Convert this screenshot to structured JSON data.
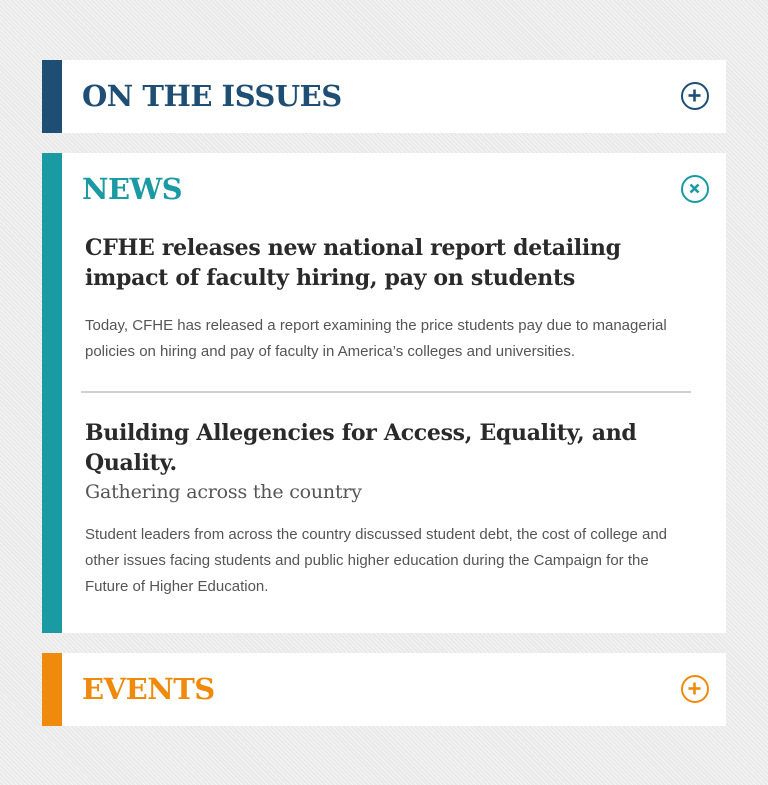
{
  "colors": {
    "issues": "#1f4e75",
    "news": "#1a9aa3",
    "events": "#ef8a0c"
  },
  "panels": {
    "issues": {
      "title": "ON THE ISSUES",
      "toggle_icon": "plus-circle-icon"
    },
    "news": {
      "title": "NEWS",
      "toggle_icon": "close-circle-icon",
      "articles": [
        {
          "title": "CFHE releases new national report detailing impact of faculty hiring, pay on students",
          "body": "Today, CFHE has released a report examining the price students pay due to managerial policies on hiring and pay of faculty in America’s colleges and universities."
        },
        {
          "title": "Building Allegencies for Access, Equality, and Quality.",
          "subtitle": "Gathering across the country",
          "body": "Student leaders from across the country discussed student debt, the cost of college and other issues facing students and public higher education during the Campaign for the Future of Higher Education."
        }
      ]
    },
    "events": {
      "title": "EVENTS",
      "toggle_icon": "plus-circle-icon"
    }
  }
}
